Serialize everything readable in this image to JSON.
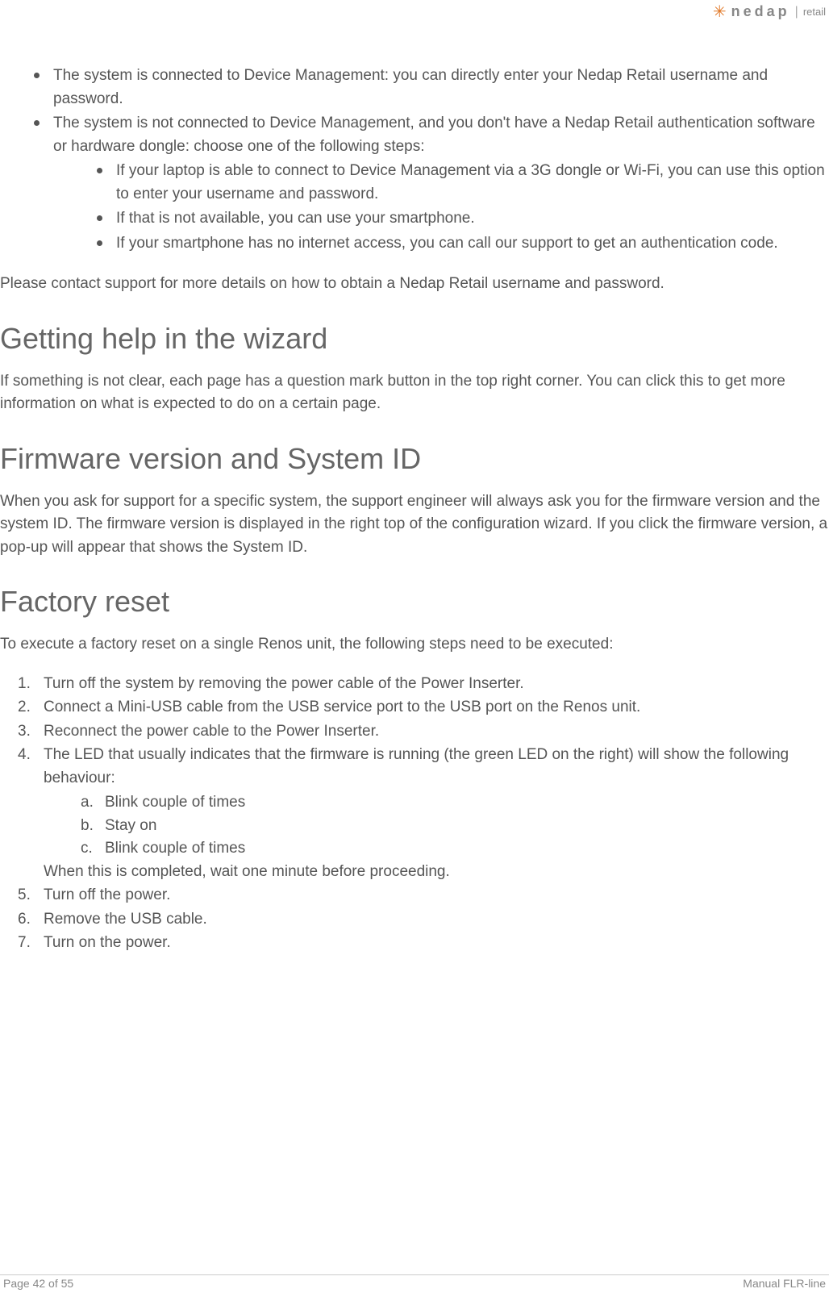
{
  "logo": {
    "brand": "nedap",
    "suffix": "retail"
  },
  "intro": {
    "bullets": [
      "The system is connected to Device Management: you can directly enter your Nedap Retail username and password.",
      "The system is not connected to Device Management, and you don't have a Nedap Retail authentication software or hardware dongle: choose one of the following steps:"
    ],
    "sub_bullets": [
      "If your laptop is able to connect to Device Management via a 3G dongle or Wi-Fi, you can use this option to enter your username and password.",
      "If that is not available, you can use your smartphone.",
      "If your smartphone has no internet access, you can call our support to get an authentication code."
    ],
    "contact": "Please contact support for more details on how to obtain a Nedap Retail username and password."
  },
  "section_help": {
    "title": "Getting help in the wizard",
    "body": "If something is not clear, each page has a question mark button in the top right corner. You can click this to get more information on what is expected to do on a certain page."
  },
  "section_firmware": {
    "title": "Firmware version and System ID",
    "body": "When you ask for support for a specific system, the support engineer will always ask you for the firmware version and the system ID. The firmware version is displayed in the right top of the configuration wizard. If you click the firmware version, a pop-up will appear that shows the System ID."
  },
  "section_factory": {
    "title": "Factory reset",
    "intro": "To execute a factory reset on a single Renos unit, the following steps need to be executed:",
    "steps": [
      "Turn off the system by removing the power cable of the Power Inserter.",
      "Connect a Mini-USB cable from the USB service port to the USB port on the Renos unit.",
      "Reconnect the power cable to the Power Inserter.",
      "The LED that usually indicates that the firmware is running (the green LED on the right) will show the following behaviour:",
      "Turn off the power.",
      "Remove the USB cable.",
      "Turn on the power."
    ],
    "step4_sub": [
      "Blink couple of times",
      "Stay on",
      "Blink couple of times"
    ],
    "step4_after": "When this is completed, wait one minute before proceeding."
  },
  "footer": {
    "page": "Page 42 of 55",
    "doc": "Manual FLR-line"
  }
}
